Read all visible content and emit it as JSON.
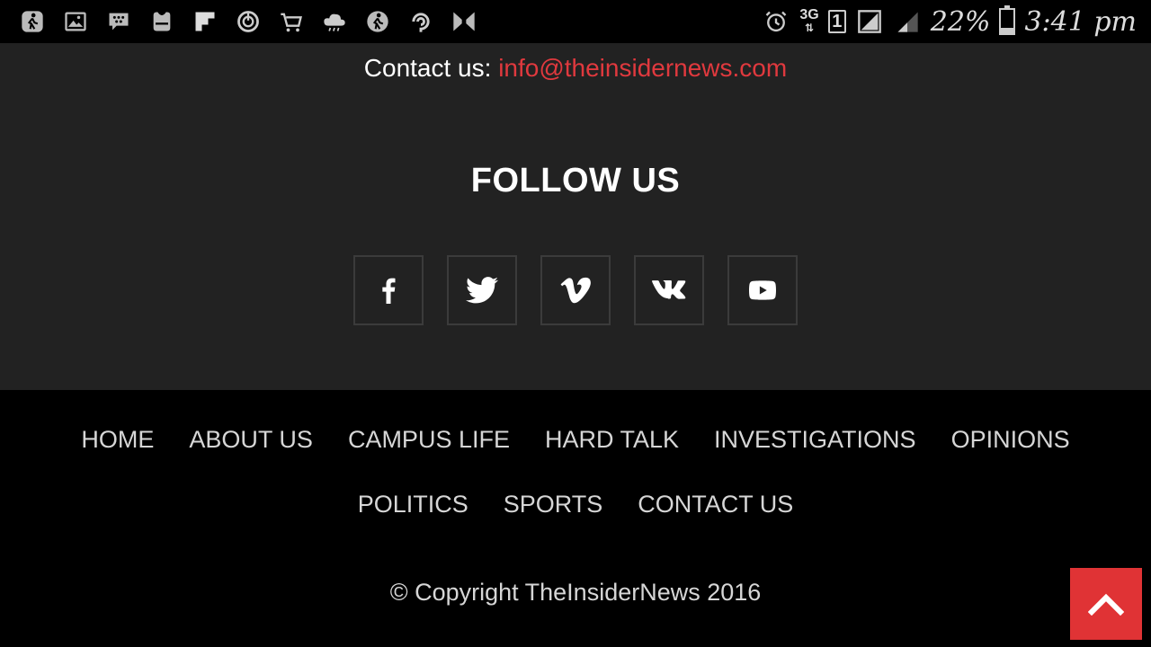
{
  "status_bar": {
    "left_icons": [
      "walk-icon",
      "image-icon",
      "bbm-icon",
      "galaxy-icon",
      "flipboard-icon",
      "sync-icon",
      "cart-icon",
      "cloud-icon",
      "walk-icon",
      "hook-icon",
      "bowtie-icon"
    ],
    "network": "3G",
    "sim": "1",
    "battery": "22%",
    "battery_level": 0.22,
    "time": "3:41 pm"
  },
  "contact": {
    "label": "Contact us: ",
    "email": "info@theinsidernews.com"
  },
  "follow": {
    "title": "FOLLOW US",
    "networks": [
      "facebook-icon",
      "twitter-icon",
      "vimeo-icon",
      "vk-icon",
      "youtube-icon"
    ]
  },
  "nav": {
    "row1": [
      "HOME",
      "ABOUT US",
      "CAMPUS LIFE",
      "HARD TALK",
      "INVESTIGATIONS",
      "OPINIONS"
    ],
    "row2": [
      "POLITICS",
      "SPORTS",
      "CONTACT US"
    ]
  },
  "copyright": "© Copyright TheInsiderNews 2016",
  "colors": {
    "accent": "#e0393e",
    "panel": "#222222",
    "background": "#000000"
  }
}
